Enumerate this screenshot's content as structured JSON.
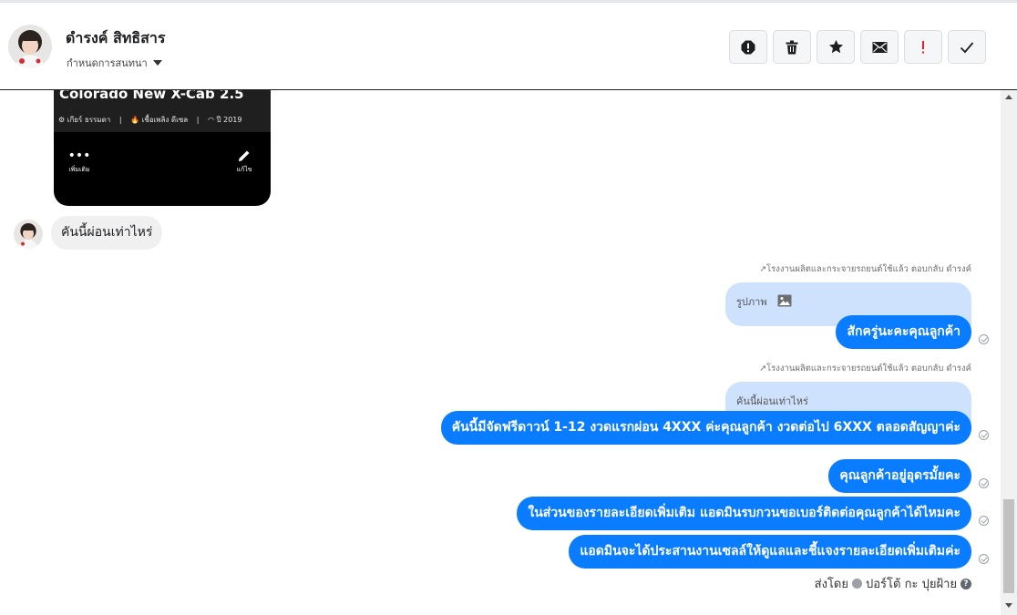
{
  "header": {
    "contact_name": "ดำรงค์ สิทธิสาร",
    "assign_label": "กำหนดการสนทนา",
    "actions": [
      {
        "name": "spam-icon"
      },
      {
        "name": "trash-icon"
      },
      {
        "name": "star-icon"
      },
      {
        "name": "envelope-icon"
      },
      {
        "name": "exclamation-icon"
      },
      {
        "name": "checkmark-icon"
      }
    ]
  },
  "card": {
    "title": "Colorado New X-Cab 2.5",
    "meta_gear": "⚙ เกียร์ ธรรมดา",
    "meta_fuel": "🔥 เชื้อเพลิง ดีเซล",
    "meta_year": "◠ ปี 2019",
    "action_more": "เพิ่มเติม",
    "action_edit": "แก้ไข"
  },
  "incoming": {
    "text": "คันนี้ผ่อนเท่าไหร่"
  },
  "replies": [
    {
      "note": "↗โรงงานผลิตและกระจายรถยนต์ใช้แล้ว ตอบกลับ ดำรงค์",
      "quote": "รูปภาพ",
      "text": "สักครู่นะคะคุณลูกค้า"
    },
    {
      "note": "↗โรงงานผลิตและกระจายรถยนต์ใช้แล้ว ตอบกลับ ดำรงค์",
      "quote": "คันนี้ผ่อนเท่าไหร่",
      "text": "คันนี้มีจัดฟรีดาวน์ 1-12 งวดแรกผ่อน 4XXX ค่ะคุณลูกค้า งวดต่อไป 6XXX ตลอดสัญญาค่ะ"
    }
  ],
  "messages": [
    {
      "text": "คุณลูกค้าอยู่อุดรมั้ยคะ"
    },
    {
      "text": "ในส่วนของรายละเอียดเพิ่มเติม แอดมินรบกวนขอเบอร์ติดต่อคุณลูกค้าได้ไหมคะ"
    },
    {
      "text": "แอดมินจะได้ประสานงานเซลล์ให้ดูแลและชี้แจงรายละเอียดเพิ่มเติมค่ะ"
    }
  ],
  "footer": {
    "sent_by_label": "ส่งโดย",
    "sender": "ปอร์โต้ กะ ปุยฝ้าย"
  },
  "colors": {
    "outgoing_bubble": "#0a7cff",
    "quote_bubble": "#cfe2fd",
    "incoming_bubble": "#f0f0f0"
  }
}
